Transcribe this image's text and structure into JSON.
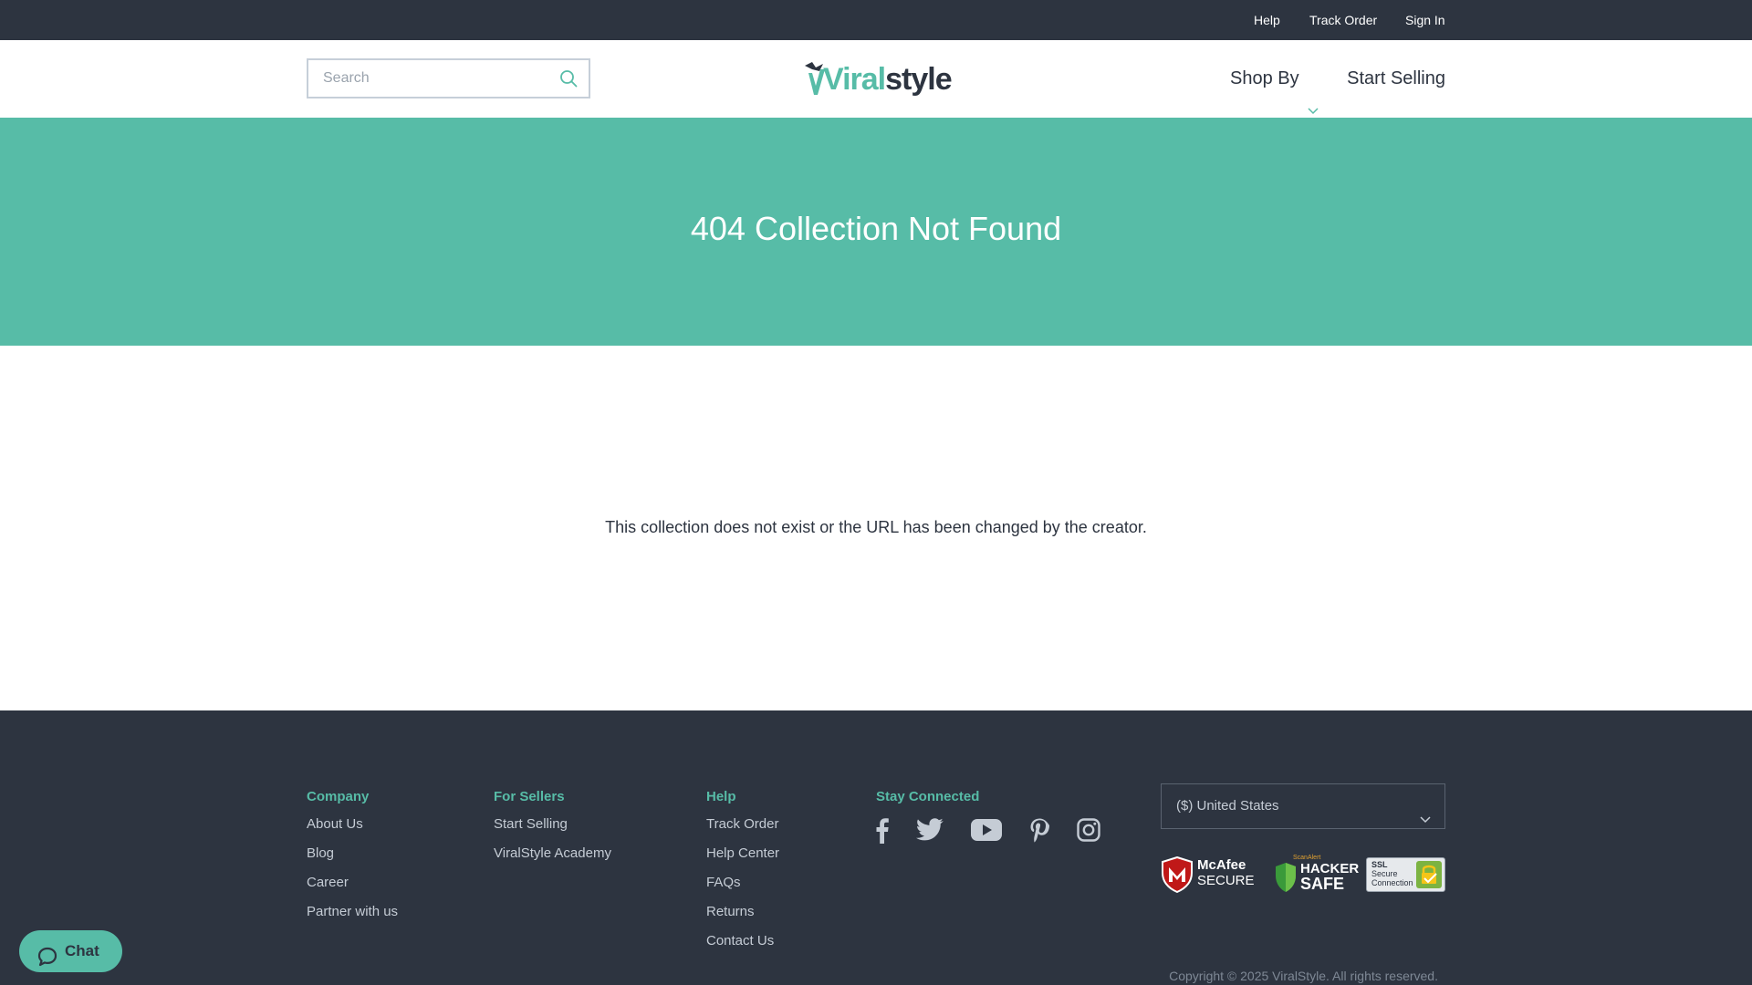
{
  "topbar": {
    "links": [
      "Help",
      "Track Order",
      "Sign In"
    ]
  },
  "header": {
    "search_placeholder": "Search",
    "logo": {
      "part1": "Viral",
      "part2": "style"
    },
    "nav": {
      "shop_by": "Shop By",
      "start_selling": "Start Selling"
    }
  },
  "hero": {
    "title": "404 Collection Not Found"
  },
  "main": {
    "message": "This collection does not exist or the URL has been changed by the creator."
  },
  "footer": {
    "company": {
      "heading": "Company",
      "links": [
        "About Us",
        "Blog",
        "Career",
        "Partner with us"
      ]
    },
    "sellers": {
      "heading": "For Sellers",
      "links": [
        "Start Selling",
        "ViralStyle Academy"
      ]
    },
    "help": {
      "heading": "Help",
      "links": [
        "Track Order",
        "Help Center",
        "FAQs",
        "Returns",
        "Contact Us"
      ]
    },
    "connected": {
      "heading": "Stay Connected",
      "icons": [
        "facebook-icon",
        "twitter-icon",
        "youtube-icon",
        "pinterest-icon",
        "instagram-icon"
      ]
    },
    "country_select": "($) United States",
    "badges": {
      "mcafee": {
        "line1": "McAfee",
        "line2": "SECURE"
      },
      "hacker": {
        "top": "ScanAlert",
        "line1": "HACKER",
        "line2": "SAFE"
      },
      "ssl": {
        "line1": "SSL",
        "line2": "Secure",
        "line3": "Connection"
      }
    },
    "copyright": "Copyright © 2025 ViralStyle. All rights reserved."
  },
  "chat": {
    "label": "Chat"
  },
  "colors": {
    "accent": "#57bca7",
    "dark": "#2d3440"
  }
}
